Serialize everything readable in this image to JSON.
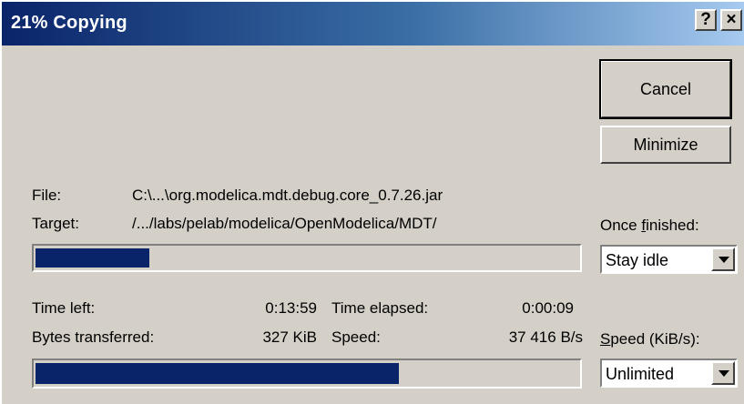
{
  "window": {
    "title": "21% Copying",
    "help_glyph": "?",
    "close_glyph": "×"
  },
  "buttons": {
    "cancel": "Cancel",
    "minimize": "Minimize"
  },
  "file": {
    "label": "File:",
    "value": "C:\\...\\org.modelica.mdt.debug.core_0.7.26.jar"
  },
  "target": {
    "label": "Target:",
    "value": "/.../labs/pelab/modelica/OpenModelica/MDT/"
  },
  "once_finished": {
    "label_pre": "Once ",
    "label_accel": "f",
    "label_post": "inished:",
    "selected": "Stay idle"
  },
  "file_progress": {
    "percent": 21
  },
  "stats": {
    "time_left_label": "Time left:",
    "time_left": "0:13:59",
    "time_elapsed_label": "Time elapsed:",
    "time_elapsed": "0:00:09",
    "bytes_label": "Bytes transferred:",
    "bytes": "327 KiB",
    "speed_label": "Speed:",
    "speed": "37 416 B/s"
  },
  "speed_limit": {
    "label_accel": "S",
    "label_post": "peed (KiB/s):",
    "selected": "Unlimited"
  },
  "total_progress": {
    "percent": 67
  },
  "colors": {
    "progress": "#0a246a",
    "face": "#d4d0c8"
  }
}
